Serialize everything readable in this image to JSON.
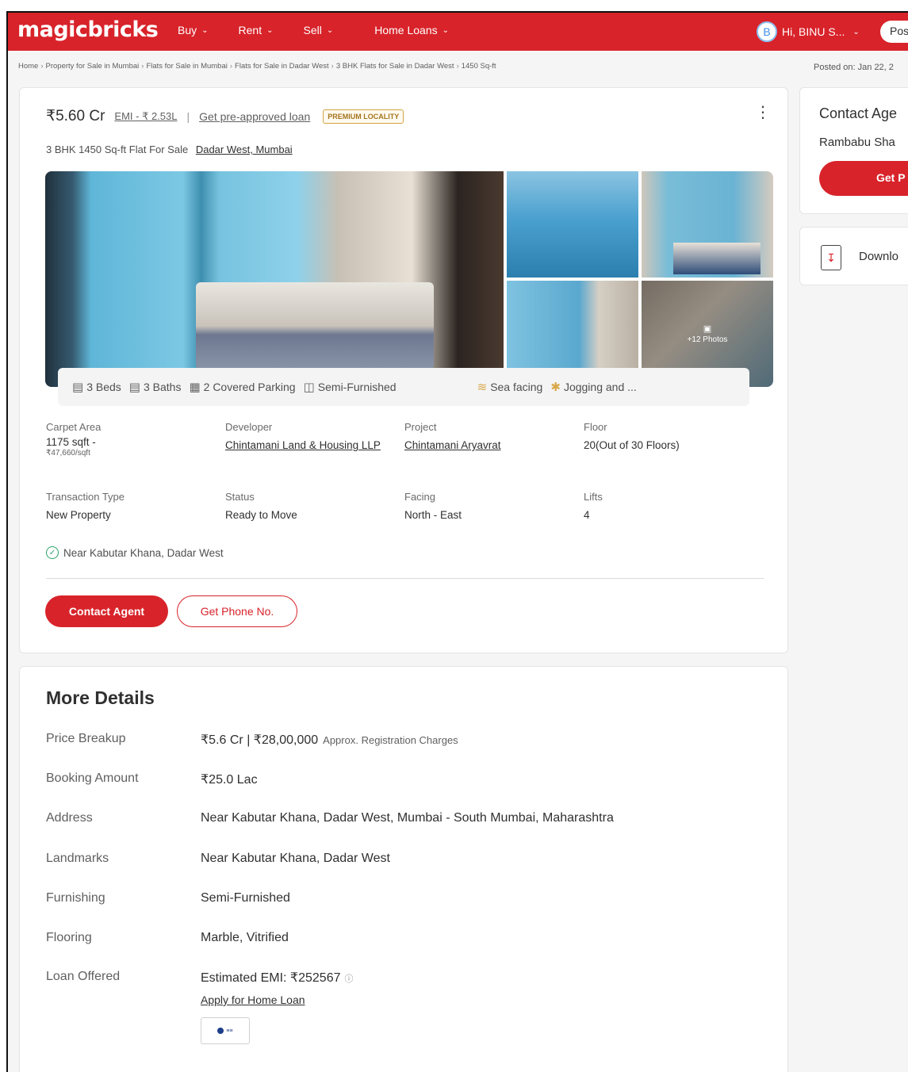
{
  "header": {
    "logo": "magicbricks",
    "nav": [
      {
        "label": "Buy"
      },
      {
        "label": "Rent"
      },
      {
        "label": "Sell"
      },
      {
        "label": "Home Loans"
      }
    ],
    "user_initial": "B",
    "user_greeting": "Hi, BINU S...",
    "post_label": "Pos",
    "brand_color": "#d8232a"
  },
  "breadcrumb": [
    "Home",
    "Property for Sale in Mumbai",
    "Flats for Sale in Mumbai",
    "Flats for Sale in Dadar West",
    "3 BHK Flats for Sale in Dadar West",
    "1450 Sq-ft"
  ],
  "posted_on": "Posted on: Jan 22, 2",
  "listing": {
    "price": "₹5.60 Cr",
    "emi": "EMI - ₹ 2.53L",
    "pipe": "|",
    "loan_link": "Get pre-approved loan",
    "badge": "PREMIUM LOCALITY",
    "title": "3 BHK 1450 Sq-ft Flat For Sale",
    "location": "Dadar West, Mumbai",
    "photos_more": "+12 Photos",
    "amenities": {
      "beds": "3 Beds",
      "baths": "3 Baths",
      "parking": "2 Covered Parking",
      "furnishing": "Semi-Furnished",
      "view": "Sea facing",
      "extra": "Jogging and ..."
    },
    "facts": {
      "carpet_label": "Carpet Area",
      "carpet_value": "1175 sqft -",
      "carpet_rate": "₹47,660/sqft",
      "developer_label": "Developer",
      "developer_value": "Chintamani Land & Housing LLP",
      "project_label": "Project",
      "project_value": "Chintamani Aryavrat",
      "floor_label": "Floor",
      "floor_value": "20(Out of 30 Floors)",
      "transaction_label": "Transaction Type",
      "transaction_value": "New Property",
      "status_label": "Status",
      "status_value": "Ready to Move",
      "facing_label": "Facing",
      "facing_value": "North - East",
      "lifts_label": "Lifts",
      "lifts_value": "4"
    },
    "near": "Near Kabutar Khana, Dadar West",
    "contact_btn": "Contact Agent",
    "phone_btn": "Get Phone No."
  },
  "more_details": {
    "title": "More Details",
    "rows": [
      {
        "label": "Price Breakup",
        "value": "₹5.6 Cr | ₹28,00,000",
        "note": "Approx. Registration Charges"
      },
      {
        "label": "Booking Amount",
        "value": "₹25.0 Lac"
      },
      {
        "label": "Address",
        "value": "Near Kabutar Khana, Dadar West, Mumbai - South Mumbai, Maharashtra"
      },
      {
        "label": "Landmarks",
        "value": "Near Kabutar Khana, Dadar West"
      },
      {
        "label": "Furnishing",
        "value": "Semi-Furnished"
      },
      {
        "label": "Flooring",
        "value": "Marble, Vitrified"
      },
      {
        "label": "Loan Offered",
        "value": "Estimated EMI: ₹252567"
      }
    ],
    "apply_link": "Apply for Home Loan"
  },
  "sidebar": {
    "contact_title": "Contact Age",
    "agent_name": "Rambabu Sha",
    "get_btn": "Get P",
    "download_label": "Downlo"
  }
}
